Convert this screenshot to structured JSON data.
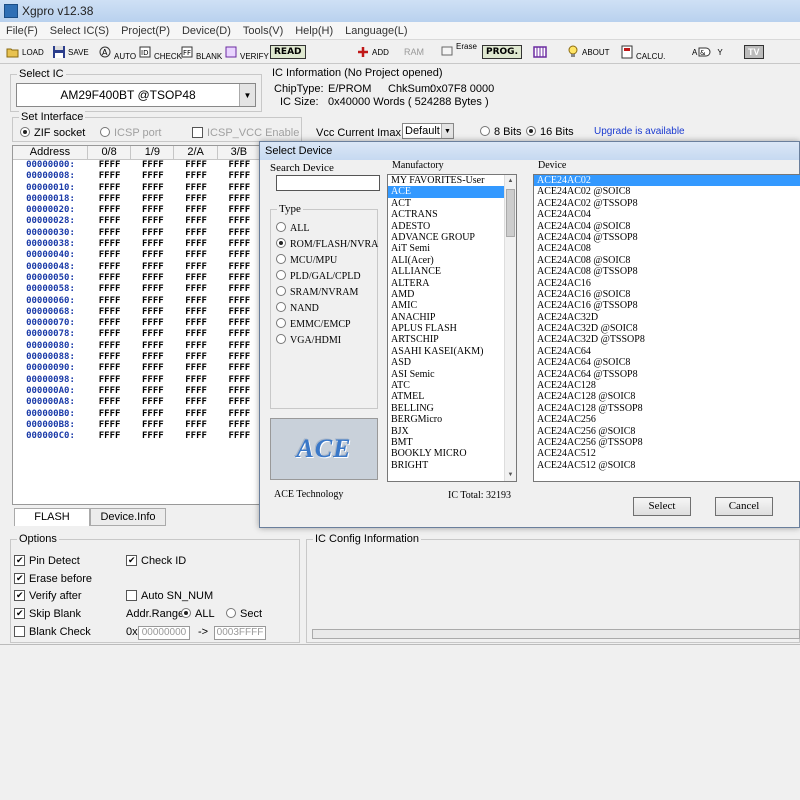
{
  "window": {
    "title": "Xgpro v12.38"
  },
  "menu": [
    "File(F)",
    "Select IC(S)",
    "Project(P)",
    "Device(D)",
    "Tools(V)",
    "Help(H)",
    "Language(L)"
  ],
  "toolbar": {
    "load": "LOAD",
    "save": "SAVE",
    "auto": "AUTO",
    "check": "CHECK",
    "blank": "BLANK",
    "verify": "VERIFY",
    "read": "READ",
    "add": "ADD",
    "ram": "RAM",
    "erase": "Erase",
    "prog": "PROG.",
    "about": "ABOUT",
    "calcu": "CALCU.",
    "logic_a": "A",
    "logic_y": "Y",
    "tv": "TV"
  },
  "select_ic": {
    "legend": "Select IC",
    "value": "AM29F400BT  @TSOP48"
  },
  "ic_info": {
    "legend": "IC Information (No Project opened)",
    "chiptype_label": "ChipType:",
    "chiptype": "E/PROM",
    "chksum_label": "ChkSum:",
    "chksum": "0x07F8 0000",
    "icsize_label": "IC Size:",
    "icsize": "0x40000 Words ( 524288 Bytes )"
  },
  "interface": {
    "legend": "Set Interface",
    "zif": "ZIF socket",
    "icsp": "ICSP port",
    "icsp_vcc": "ICSP_VCC Enable",
    "vcc_label": "Vcc Current Imax:",
    "vcc_value": "Default",
    "bits8": "8 Bits",
    "bits16": "16 Bits",
    "upgrade": "Upgrade is available",
    "upgrade_color": "#1a3ad0"
  },
  "hex": {
    "headers": [
      "Address",
      "0/8",
      "1/9",
      "2/A",
      "3/B"
    ],
    "rows": [
      [
        "00000000:",
        "FFFF",
        "FFFF",
        "FFFF",
        "FFFF"
      ],
      [
        "00000008:",
        "FFFF",
        "FFFF",
        "FFFF",
        "FFFF"
      ],
      [
        "00000010:",
        "FFFF",
        "FFFF",
        "FFFF",
        "FFFF"
      ],
      [
        "00000018:",
        "FFFF",
        "FFFF",
        "FFFF",
        "FFFF"
      ],
      [
        "00000020:",
        "FFFF",
        "FFFF",
        "FFFF",
        "FFFF"
      ],
      [
        "00000028:",
        "FFFF",
        "FFFF",
        "FFFF",
        "FFFF"
      ],
      [
        "00000030:",
        "FFFF",
        "FFFF",
        "FFFF",
        "FFFF"
      ],
      [
        "00000038:",
        "FFFF",
        "FFFF",
        "FFFF",
        "FFFF"
      ],
      [
        "00000040:",
        "FFFF",
        "FFFF",
        "FFFF",
        "FFFF"
      ],
      [
        "00000048:",
        "FFFF",
        "FFFF",
        "FFFF",
        "FFFF"
      ],
      [
        "00000050:",
        "FFFF",
        "FFFF",
        "FFFF",
        "FFFF"
      ],
      [
        "00000058:",
        "FFFF",
        "FFFF",
        "FFFF",
        "FFFF"
      ],
      [
        "00000060:",
        "FFFF",
        "FFFF",
        "FFFF",
        "FFFF"
      ],
      [
        "00000068:",
        "FFFF",
        "FFFF",
        "FFFF",
        "FFFF"
      ],
      [
        "00000070:",
        "FFFF",
        "FFFF",
        "FFFF",
        "FFFF"
      ],
      [
        "00000078:",
        "FFFF",
        "FFFF",
        "FFFF",
        "FFFF"
      ],
      [
        "00000080:",
        "FFFF",
        "FFFF",
        "FFFF",
        "FFFF"
      ],
      [
        "00000088:",
        "FFFF",
        "FFFF",
        "FFFF",
        "FFFF"
      ],
      [
        "00000090:",
        "FFFF",
        "FFFF",
        "FFFF",
        "FFFF"
      ],
      [
        "00000098:",
        "FFFF",
        "FFFF",
        "FFFF",
        "FFFF"
      ],
      [
        "000000A0:",
        "FFFF",
        "FFFF",
        "FFFF",
        "FFFF"
      ],
      [
        "000000A8:",
        "FFFF",
        "FFFF",
        "FFFF",
        "FFFF"
      ],
      [
        "000000B0:",
        "FFFF",
        "FFFF",
        "FFFF",
        "FFFF"
      ],
      [
        "000000B8:",
        "FFFF",
        "FFFF",
        "FFFF",
        "FFFF"
      ],
      [
        "000000C0:",
        "FFFF",
        "FFFF",
        "FFFF",
        "FFFF"
      ]
    ],
    "tab_flash": "FLASH",
    "tab_devinfo": "Device.Info"
  },
  "options": {
    "legend": "Options",
    "pin_detect": "Pin Detect",
    "check_id": "Check ID",
    "erase_before": "Erase before",
    "verify_after": "Verify after",
    "auto_sn": "Auto SN_NUM",
    "skip_blank": "Skip Blank",
    "addr_range": "Addr.Range:",
    "all": "ALL",
    "sect": "Sect",
    "blank_check": "Blank Check",
    "ox": "0x",
    "addr_from": "00000000",
    "arrow": "->",
    "addr_to": "0003FFFF"
  },
  "ic_config": {
    "legend": "IC Config Information"
  },
  "dialog": {
    "title": "Select Device",
    "search_legend": "Search Device",
    "type_legend": "Type",
    "types": [
      "ALL",
      "ROM/FLASH/NVRA",
      "MCU/MPU",
      "PLD/GAL/CPLD",
      "SRAM/NVRAM",
      "NAND",
      "EMMC/EMCP",
      "VGA/HDMI"
    ],
    "type_selected": 1,
    "manufactory_legend": "Manufactory",
    "manufactories": [
      "MY FAVORITES-User",
      "ACE",
      "ACT",
      "ACTRANS",
      "ADESTO",
      "ADVANCE GROUP",
      "AiT Semi",
      "ALI(Acer)",
      "ALLIANCE",
      "ALTERA",
      "AMD",
      "AMIC",
      "ANACHIP",
      "APLUS FLASH",
      "ARTSCHIP",
      "ASAHI KASEI(AKM)",
      "ASD",
      "ASI Semic",
      "ATC",
      "ATMEL",
      "BELLING",
      "BERGMicro",
      "BJX",
      "BMT",
      "BOOKLY MICRO",
      "BRIGHT"
    ],
    "manufactory_selected": 1,
    "device_legend": "Device",
    "devices": [
      "ACE24AC02",
      "ACE24AC02 @SOIC8",
      "ACE24AC02 @TSSOP8",
      "ACE24AC04",
      "ACE24AC04 @SOIC8",
      "ACE24AC04 @TSSOP8",
      "ACE24AC08",
      "ACE24AC08 @SOIC8",
      "ACE24AC08 @TSSOP8",
      "ACE24AC16",
      "ACE24AC16 @SOIC8",
      "ACE24AC16 @TSSOP8",
      "ACE24AC32D",
      "ACE24AC32D @SOIC8",
      "ACE24AC32D @TSSOP8",
      "ACE24AC64",
      "ACE24AC64 @SOIC8",
      "ACE24AC64 @TSSOP8",
      "ACE24AC128",
      "ACE24AC128 @SOIC8",
      "ACE24AC128 @TSSOP8",
      "ACE24AC256",
      "ACE24AC256 @SOIC8",
      "ACE24AC256 @TSSOP8",
      "ACE24AC512",
      "ACE24AC512 @SOIC8"
    ],
    "device_selected": 0,
    "logo_text": "ACE",
    "manufacturer_name": "ACE Technology",
    "ic_total": "IC Total:  32193",
    "select_btn": "Select",
    "cancel_btn": "Cancel",
    "selection_color": "#3399ff"
  }
}
